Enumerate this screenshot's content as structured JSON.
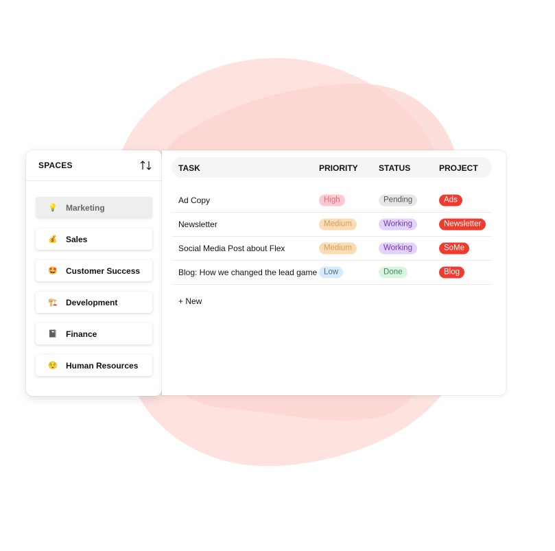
{
  "colors": {
    "blob_primary": "#fde0dd",
    "blob_secondary": "#fbd0cc",
    "project_tag": "#f03c2e"
  },
  "sidebar": {
    "title": "SPACES",
    "sort_icon": "sort-arrows-icon",
    "items": [
      {
        "label": "Marketing",
        "emoji": "💡",
        "active": true
      },
      {
        "label": "Sales",
        "emoji": "💰",
        "active": false
      },
      {
        "label": "Customer Success",
        "emoji": "🤩",
        "active": false
      },
      {
        "label": "Development",
        "emoji": "🏗️",
        "active": false
      },
      {
        "label": "Finance",
        "emoji": "📓",
        "active": false
      },
      {
        "label": "Human Resources",
        "emoji": "😌",
        "active": false
      }
    ]
  },
  "table": {
    "columns": {
      "task": "TASK",
      "priority": "PRIORITY",
      "status": "STATUS",
      "project": "PROJECT"
    },
    "rows": [
      {
        "task": "Ad Copy",
        "priority": "High",
        "status": "Pending",
        "project": "Ads"
      },
      {
        "task": "Newsletter",
        "priority": "Medium",
        "status": "Working",
        "project": "Newsletter"
      },
      {
        "task": "Social Media Post about Flex",
        "priority": "Medium",
        "status": "Working",
        "project": "SoMe"
      },
      {
        "task": "Blog: How we changed the lead game",
        "priority": "Low",
        "status": "Done",
        "project": "Blog"
      }
    ],
    "new_label": "+ New"
  }
}
